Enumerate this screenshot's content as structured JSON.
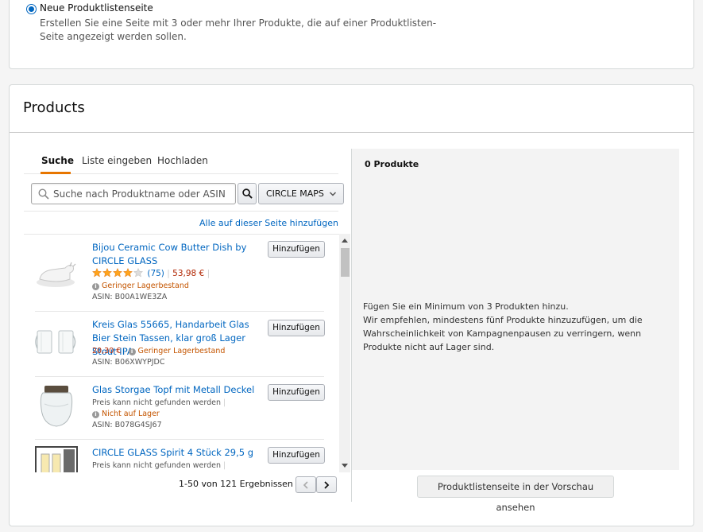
{
  "page_type": {
    "radio_label": "Neue Produktlistenseite",
    "radio_description": "Erstellen Sie eine Seite mit 3 oder mehr Ihrer Produkte, die auf einer Produktlisten-Seite angezeigt werden sollen."
  },
  "products_section": {
    "title": "Products",
    "tabs": [
      {
        "label": "Suche",
        "active": true
      },
      {
        "label": "Liste eingeben",
        "active": false
      },
      {
        "label": "Hochladen",
        "active": false
      }
    ],
    "search": {
      "placeholder": "Suche nach Produktname oder ASIN",
      "value": ""
    },
    "brand_filter": "CIRCLE MAPS",
    "add_all_label": "Alle auf dieser Seite hinzufügen",
    "items": [
      {
        "title": "Bijou Ceramic Cow Butter Dish by CIRCLE GLASS",
        "rating_count": "(75)",
        "rating_value": 4,
        "price": "53,98 €",
        "stock": "Geringer Lagerbestand",
        "asin": "ASIN: B00A1WE3ZA",
        "add_label": "Hinzufügen"
      },
      {
        "title": "Kreis Glas 55665, Handarbeit Glas Bier Stein Tassen, klar groß Lager Stout IPA",
        "price": "20,30 €",
        "stock": "Geringer Lagerbestand",
        "asin": "ASIN: B06XWYPJDC",
        "add_label": "Hinzufügen"
      },
      {
        "title": "Glas Storgae Topf mit Metall Deckel",
        "price_note": "Preis kann nicht gefunden werden",
        "stock": "Nicht auf Lager",
        "asin": "ASIN: B078G4SJ67",
        "add_label": "Hinzufügen"
      },
      {
        "title": "CIRCLE GLASS Spirit 4 Stück 29,5 g",
        "price_note": "Preis kann nicht gefunden werden",
        "add_label": "Hinzufügen"
      }
    ],
    "results_text": "1-50 von 121 Ergebnissen",
    "selected": {
      "count_label": "0 Produkte",
      "message_line1": "Fügen Sie ein Minimum von 3 Produkten hinzu.",
      "message_line2": "Wir empfehlen, mindestens fünf Produkte hinzuzufügen, um die Wahrscheinlichkeit von Kampagnenpausen zu verringern, wenn Produkte nicht auf Lager sind."
    },
    "preview_label": "Produktlistenseite in der Vorschau ansehen"
  },
  "colors": {
    "link": "#0066c0",
    "tab_accent": "#e77600",
    "low_stock": "#c45500",
    "price": "#b12704",
    "star": "#ffa41c"
  }
}
